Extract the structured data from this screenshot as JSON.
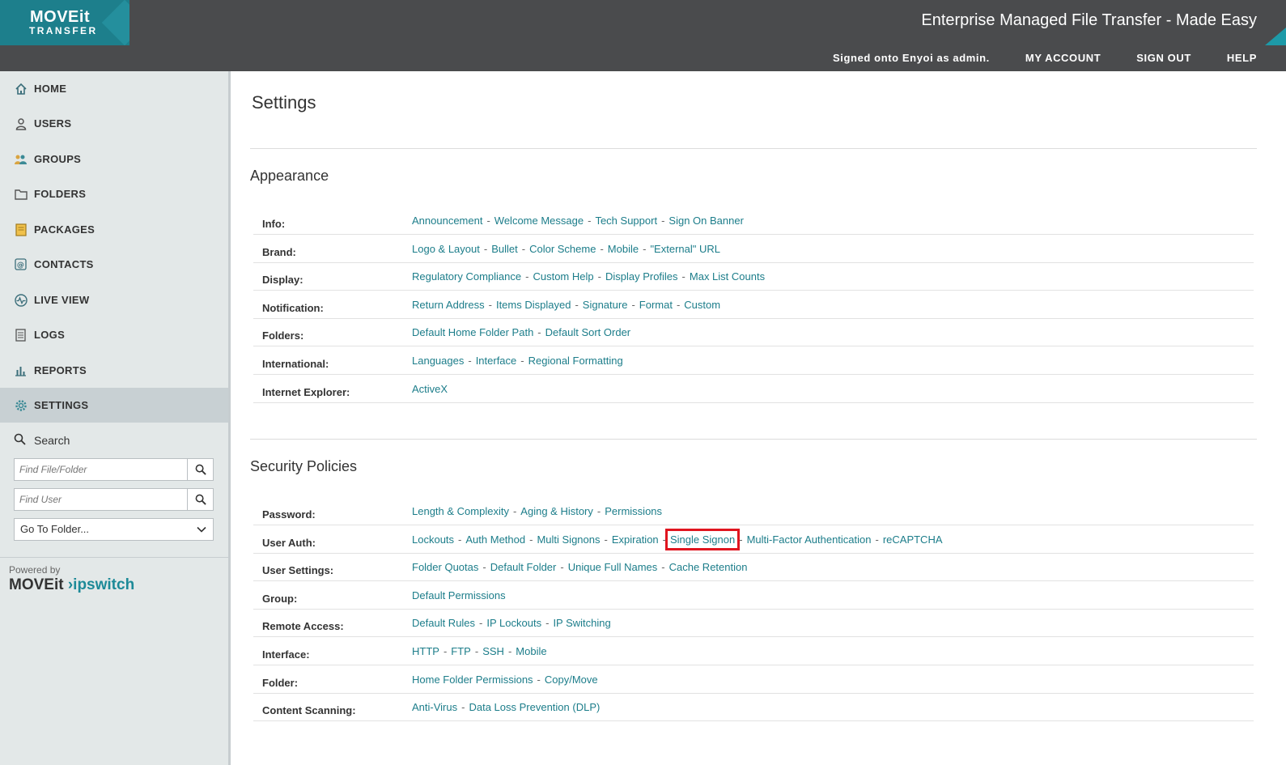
{
  "header": {
    "logo_line1": "MOVEit",
    "logo_line2": "TRANSFER",
    "tagline": "Enterprise Managed File Transfer - Made Easy",
    "signed_on": "Signed onto Enyoi as admin.",
    "my_account": "MY ACCOUNT",
    "sign_out": "SIGN OUT",
    "help": "HELP"
  },
  "sidebar": {
    "items": [
      {
        "label": "HOME",
        "icon": "home-icon"
      },
      {
        "label": "USERS",
        "icon": "user-icon"
      },
      {
        "label": "GROUPS",
        "icon": "group-icon"
      },
      {
        "label": "FOLDERS",
        "icon": "folder-icon"
      },
      {
        "label": "PACKAGES",
        "icon": "package-icon"
      },
      {
        "label": "CONTACTS",
        "icon": "contacts-icon"
      },
      {
        "label": "LIVE VIEW",
        "icon": "live-view-icon"
      },
      {
        "label": "LOGS",
        "icon": "logs-icon"
      },
      {
        "label": "REPORTS",
        "icon": "reports-icon"
      },
      {
        "label": "SETTINGS",
        "icon": "settings-icon"
      }
    ],
    "active": "SETTINGS",
    "search_label": "Search",
    "find_file_placeholder": "Find File/Folder",
    "find_user_placeholder": "Find User",
    "goto_folder": "Go To Folder...",
    "powered_by": "Powered by",
    "powered_logo_a": "MOVEit",
    "powered_logo_b": "ipswitch"
  },
  "main": {
    "title": "Settings",
    "appearance": {
      "title": "Appearance",
      "rows": [
        {
          "label": "Info:",
          "links": [
            "Announcement",
            "Welcome Message",
            "Tech Support",
            "Sign On Banner"
          ]
        },
        {
          "label": "Brand:",
          "links": [
            "Logo & Layout",
            "Bullet",
            "Color Scheme",
            "Mobile",
            "\"External\" URL"
          ]
        },
        {
          "label": "Display:",
          "links": [
            "Regulatory Compliance",
            "Custom Help",
            "Display Profiles",
            "Max List Counts"
          ]
        },
        {
          "label": "Notification:",
          "links": [
            "Return Address",
            "Items Displayed",
            "Signature",
            "Format",
            "Custom"
          ]
        },
        {
          "label": "Folders:",
          "links": [
            "Default Home Folder Path",
            "Default Sort Order"
          ]
        },
        {
          "label": "International:",
          "links": [
            "Languages",
            "Interface",
            "Regional Formatting"
          ]
        },
        {
          "label": "Internet Explorer:",
          "links": [
            "ActiveX"
          ]
        }
      ]
    },
    "security": {
      "title": "Security Policies",
      "rows": [
        {
          "label": "Password:",
          "links": [
            "Length & Complexity",
            "Aging & History",
            "Permissions"
          ]
        },
        {
          "label": "User Auth:",
          "links": [
            "Lockouts",
            "Auth Method",
            "Multi Signons",
            "Expiration",
            "Single Signon",
            "Multi-Factor Authentication",
            "reCAPTCHA"
          ]
        },
        {
          "label": "User Settings:",
          "links": [
            "Folder Quotas",
            "Default Folder",
            "Unique Full Names",
            "Cache Retention"
          ]
        },
        {
          "label": "Group:",
          "links": [
            "Default Permissions"
          ]
        },
        {
          "label": "Remote Access:",
          "links": [
            "Default Rules",
            "IP Lockouts",
            "IP Switching"
          ]
        },
        {
          "label": "Interface:",
          "links": [
            "HTTP",
            "FTP",
            "SSH",
            "Mobile"
          ]
        },
        {
          "label": "Folder:",
          "links": [
            "Home Folder Permissions",
            "Copy/Move"
          ]
        },
        {
          "label": "Content Scanning:",
          "links": [
            "Anti-Virus",
            "Data Loss Prevention (DLP)"
          ]
        }
      ]
    },
    "highlighted_link": "Single Signon"
  },
  "colors": {
    "header_bg": "#4a4b4d",
    "logo_bg": "#1d7f8c",
    "sidebar_bg": "#e3e8e8",
    "link": "#1c7d8a",
    "highlight": "#e0151f"
  }
}
